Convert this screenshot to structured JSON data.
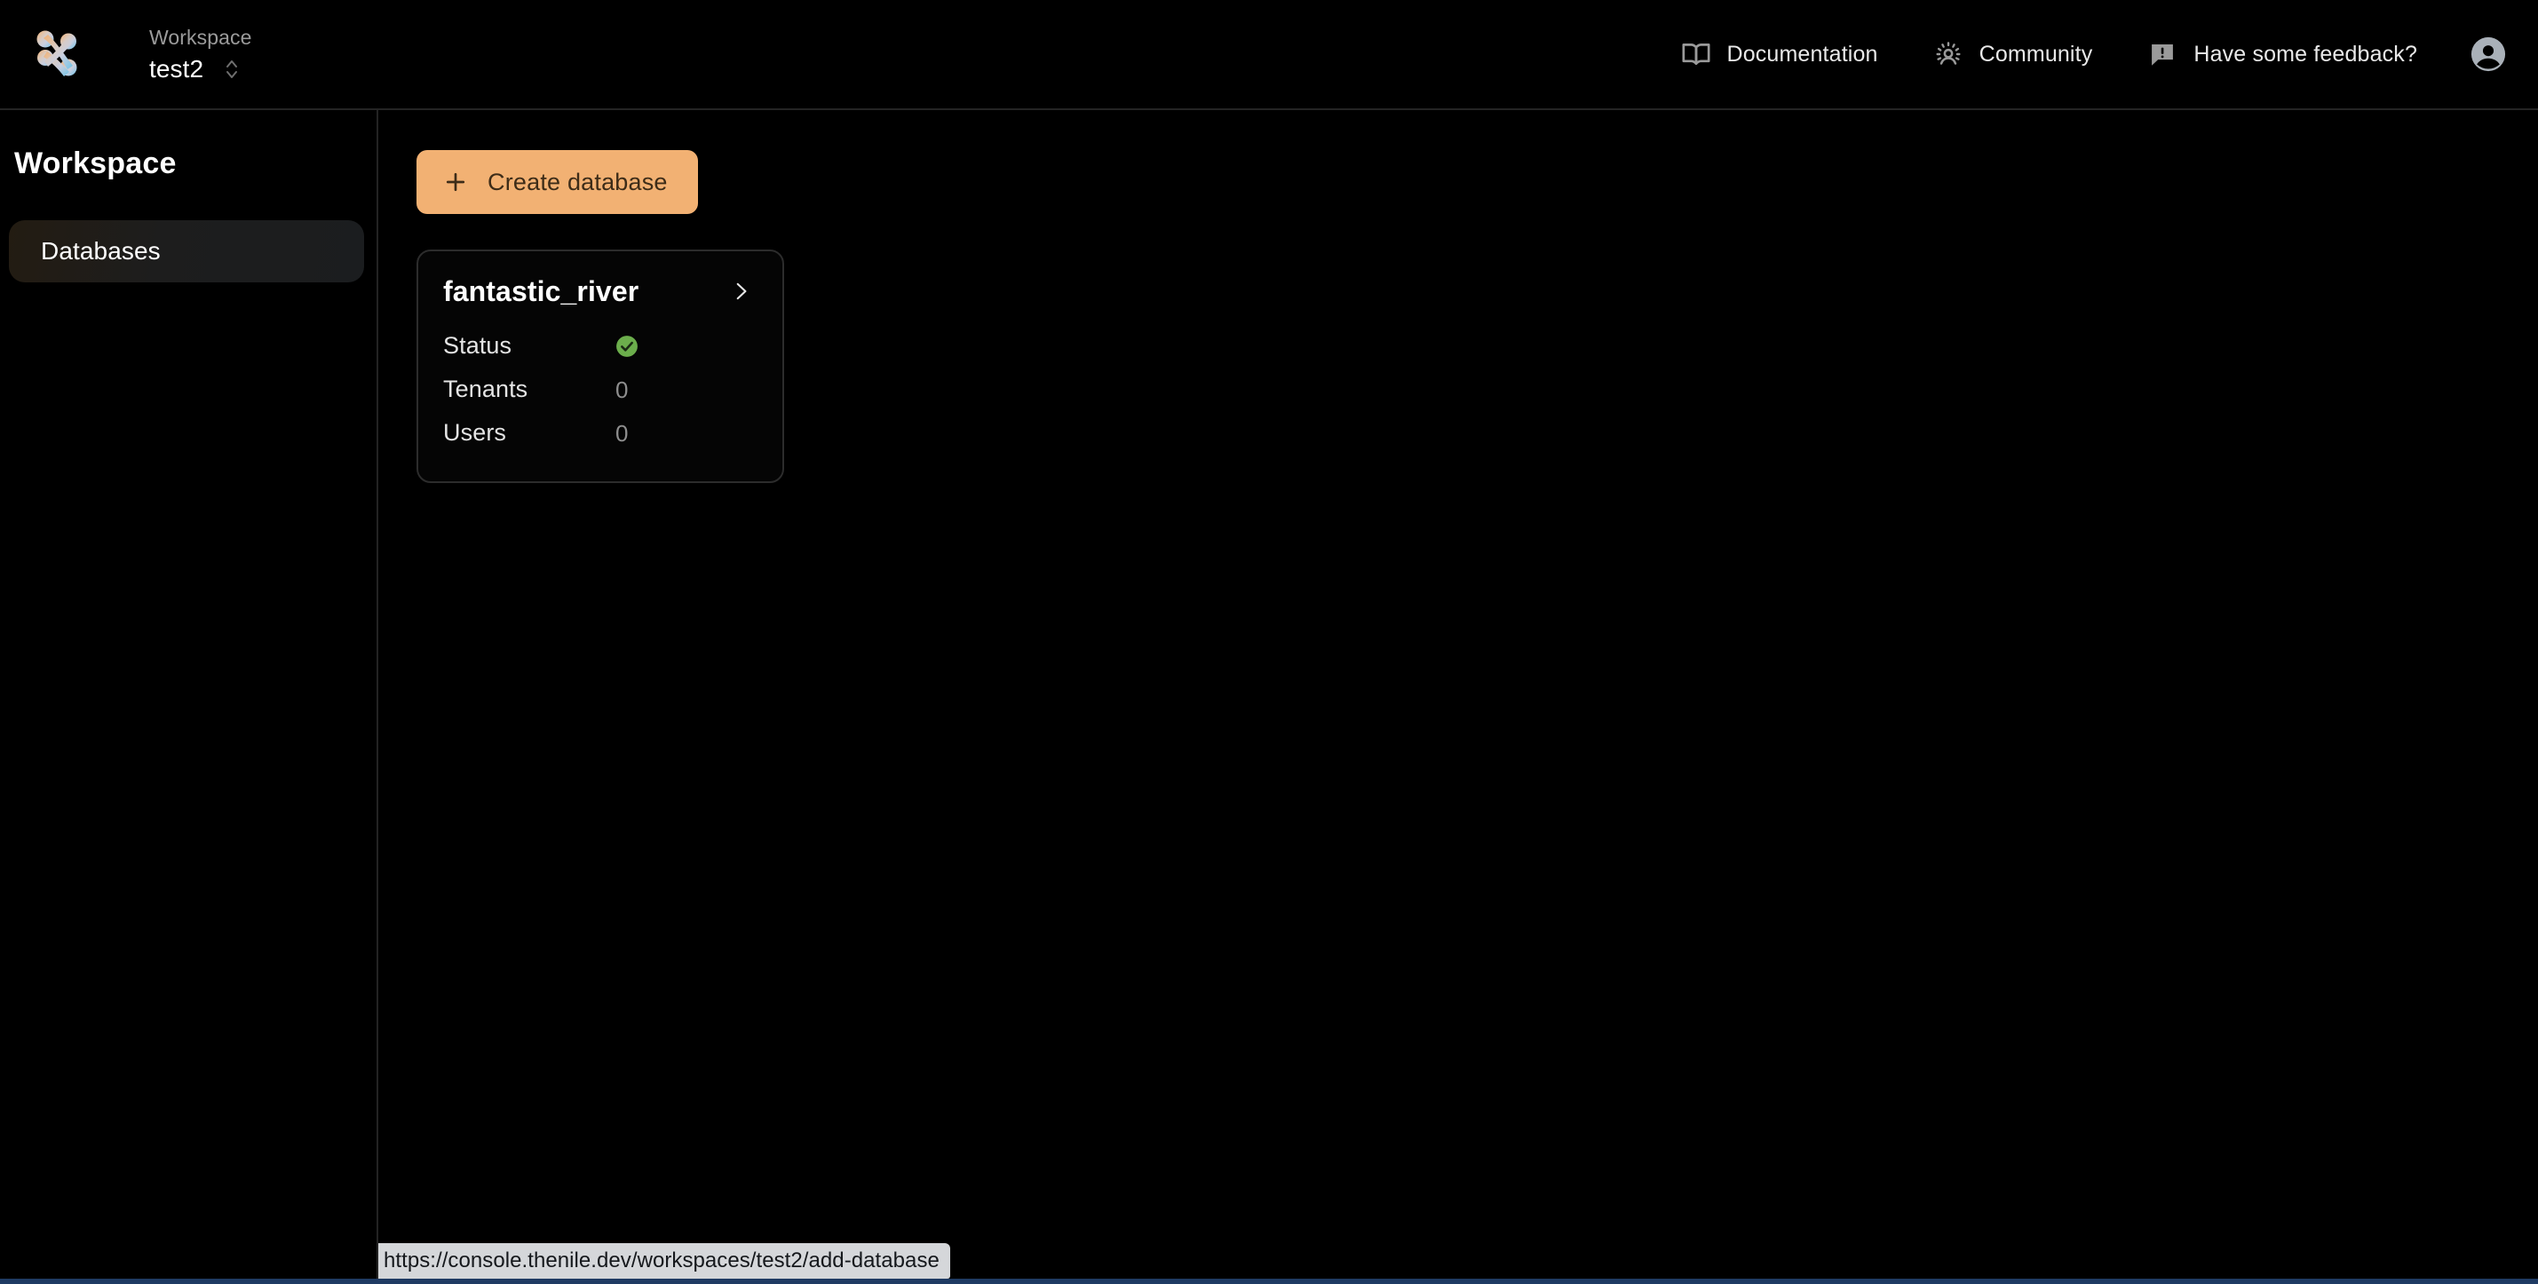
{
  "topbar": {
    "logo_icon": "nile-logo-icon",
    "workspace": {
      "label": "Workspace",
      "value": "test2",
      "selector_icon": "chevron-up-down-icon"
    },
    "nav": [
      {
        "label": "Documentation",
        "icon": "book-open-icon"
      },
      {
        "label": "Community",
        "icon": "community-person-icon"
      },
      {
        "label": "Have some feedback?",
        "icon": "feedback-message-icon"
      }
    ],
    "account": {
      "icon": "user-avatar-icon"
    }
  },
  "sidebar": {
    "title": "Workspace",
    "items": [
      {
        "label": "Databases",
        "active": true
      }
    ]
  },
  "main": {
    "create_button": {
      "label": "Create database",
      "icon": "plus-icon"
    },
    "databases": [
      {
        "name": "fantastic_river",
        "open_icon": "chevron-right-icon",
        "stats": [
          {
            "label": "Status",
            "value": "",
            "type": "badge",
            "badge_icon": "check-circle-icon"
          },
          {
            "label": "Tenants",
            "value": "0",
            "type": "number"
          },
          {
            "label": "Users",
            "value": "0",
            "type": "number"
          }
        ]
      }
    ]
  },
  "status_bar": {
    "url": "https://console.thenile.dev/workspaces/test2/add-database"
  },
  "colors": {
    "background": "#000000",
    "accent": "#f2b173",
    "accent_text": "#3d2c18",
    "status_ok": "#6cae4c",
    "border": "#2c2c2c",
    "muted_text": "#8e8e8e",
    "status_bar_bg": "#d5d7da"
  }
}
